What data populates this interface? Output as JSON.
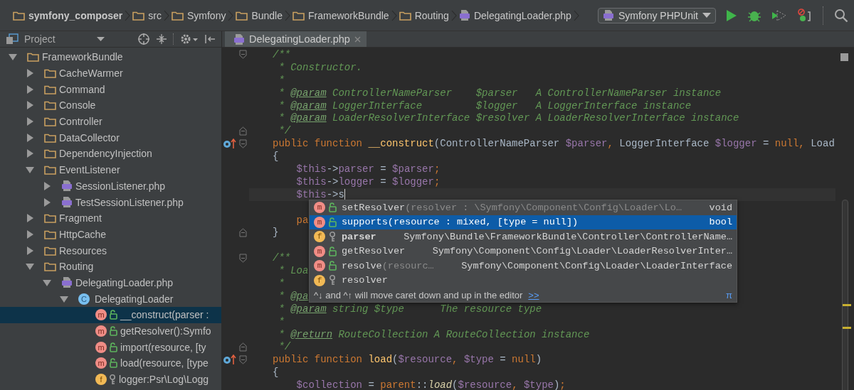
{
  "breadcrumbs": [
    {
      "label": "symfony_composer",
      "kind": "folder",
      "bold": true
    },
    {
      "label": "src",
      "kind": "folder",
      "bold": false
    },
    {
      "label": "Symfony",
      "kind": "folder",
      "bold": false
    },
    {
      "label": "Bundle",
      "kind": "folder",
      "bold": false
    },
    {
      "label": "FrameworkBundle",
      "kind": "folder",
      "bold": false
    },
    {
      "label": "Routing",
      "kind": "folder",
      "bold": false
    },
    {
      "label": "DelegatingLoader.php",
      "kind": "php",
      "bold": false
    }
  ],
  "run_config": {
    "label": "Symfony PHPUnit"
  },
  "project_panel": {
    "title": "Project",
    "tree": [
      {
        "label": "FrameworkBundle",
        "kind": "folder",
        "expanded": true,
        "selected": false,
        "children": [
          {
            "label": "CacheWarmer",
            "kind": "folder",
            "expanded": false,
            "selected": false
          },
          {
            "label": "Command",
            "kind": "folder",
            "expanded": false,
            "selected": false
          },
          {
            "label": "Console",
            "kind": "folder",
            "expanded": false,
            "selected": false
          },
          {
            "label": "Controller",
            "kind": "folder",
            "expanded": false,
            "selected": false
          },
          {
            "label": "DataCollector",
            "kind": "folder",
            "expanded": false,
            "selected": false
          },
          {
            "label": "DependencyInjection",
            "kind": "folder",
            "expanded": false,
            "selected": false
          },
          {
            "label": "EventListener",
            "kind": "folder",
            "expanded": true,
            "selected": false,
            "children": [
              {
                "label": "SessionListener.php",
                "kind": "php",
                "expanded": false,
                "selected": false
              },
              {
                "label": "TestSessionListener.php",
                "kind": "php",
                "expanded": false,
                "selected": false
              }
            ]
          },
          {
            "label": "Fragment",
            "kind": "folder",
            "expanded": false,
            "selected": false
          },
          {
            "label": "HttpCache",
            "kind": "folder",
            "expanded": false,
            "selected": false
          },
          {
            "label": "Resources",
            "kind": "folder",
            "expanded": false,
            "selected": false
          },
          {
            "label": "Routing",
            "kind": "folder",
            "expanded": true,
            "selected": false,
            "children": [
              {
                "label": "DelegatingLoader.php",
                "kind": "php",
                "expanded": true,
                "selected": false,
                "children": [
                  {
                    "label": "DelegatingLoader",
                    "kind": "class",
                    "badge": "C",
                    "expanded": true,
                    "selected": false,
                    "children": [
                      {
                        "label": "__construct(parser :",
                        "kind": "method",
                        "badge": "m",
                        "selected": true
                      },
                      {
                        "label": "getResolver():Symfo",
                        "kind": "method",
                        "badge": "m",
                        "selected": false
                      },
                      {
                        "label": "import(resource, [ty",
                        "kind": "method",
                        "badge": "m",
                        "selected": false
                      },
                      {
                        "label": "load(resource, [type",
                        "kind": "method",
                        "badge": "m",
                        "selected": false
                      },
                      {
                        "label": "logger:Psr\\Log\\Logg",
                        "kind": "field",
                        "badge": "f",
                        "selected": false
                      }
                    ]
                  }
                ]
              }
            ]
          }
        ]
      }
    ]
  },
  "editor": {
    "tabs": [
      {
        "label": "DelegatingLoader.php",
        "selected": true
      }
    ],
    "lines": [
      {
        "current": false,
        "fold_start": true,
        "fold_end": false,
        "overrides": false,
        "tokens": [
          {
            "kind": "comment",
            "text": "/**"
          }
        ]
      },
      {
        "current": false,
        "fold_start": false,
        "fold_end": false,
        "overrides": false,
        "tokens": [
          {
            "kind": "comment",
            "text": " * Constructor."
          }
        ]
      },
      {
        "current": false,
        "fold_start": false,
        "fold_end": false,
        "overrides": false,
        "tokens": [
          {
            "kind": "comment",
            "text": " *"
          }
        ]
      },
      {
        "current": false,
        "fold_start": false,
        "fold_end": false,
        "overrides": false,
        "tokens": [
          {
            "kind": "comment",
            "text": " * "
          },
          {
            "kind": "tag",
            "text": "@param"
          },
          {
            "kind": "comment",
            "text": " ControllerNameParser    $parser   A ControllerNameParser instance"
          }
        ]
      },
      {
        "current": false,
        "fold_start": false,
        "fold_end": false,
        "overrides": false,
        "tokens": [
          {
            "kind": "comment",
            "text": " * "
          },
          {
            "kind": "tag",
            "text": "@param"
          },
          {
            "kind": "comment",
            "text": " LoggerInterface         $logger   A LoggerInterface instance"
          }
        ]
      },
      {
        "current": false,
        "fold_start": false,
        "fold_end": false,
        "overrides": false,
        "tokens": [
          {
            "kind": "comment",
            "text": " * "
          },
          {
            "kind": "tag",
            "text": "@param"
          },
          {
            "kind": "comment",
            "text": " LoaderResolverInterface $resolver A LoaderResolverInterface instance"
          }
        ]
      },
      {
        "current": false,
        "fold_start": false,
        "fold_end": true,
        "overrides": false,
        "tokens": [
          {
            "kind": "comment",
            "text": " */"
          }
        ]
      },
      {
        "current": false,
        "fold_start": true,
        "fold_end": false,
        "overrides": true,
        "tokens": [
          {
            "kind": "keyword",
            "text": "public function "
          },
          {
            "kind": "function",
            "text": "__construct"
          },
          {
            "kind": "plain",
            "text": "(ControllerNameParser "
          },
          {
            "kind": "variable",
            "text": "$parser"
          },
          {
            "kind": "keyword",
            "text": ", "
          },
          {
            "kind": "plain",
            "text": "LoggerInterface "
          },
          {
            "kind": "variable",
            "text": "$logger"
          },
          {
            "kind": "plain",
            "text": " = "
          },
          {
            "kind": "keyword",
            "text": "null, "
          },
          {
            "kind": "plain",
            "text": "Load"
          }
        ]
      },
      {
        "current": false,
        "fold_start": false,
        "fold_end": false,
        "overrides": false,
        "tokens": [
          {
            "kind": "plain",
            "text": "{"
          }
        ]
      },
      {
        "current": false,
        "fold_start": false,
        "fold_end": false,
        "overrides": false,
        "tokens": [
          {
            "kind": "variable",
            "text": "    $this"
          },
          {
            "kind": "plain",
            "text": "->"
          },
          {
            "kind": "variable",
            "text": "parser"
          },
          {
            "kind": "plain",
            "text": " = "
          },
          {
            "kind": "variable",
            "text": "$parser"
          },
          {
            "kind": "keyword",
            "text": ";"
          }
        ]
      },
      {
        "current": false,
        "fold_start": false,
        "fold_end": false,
        "overrides": false,
        "tokens": [
          {
            "kind": "variable",
            "text": "    $this"
          },
          {
            "kind": "plain",
            "text": "->"
          },
          {
            "kind": "variable",
            "text": "logger"
          },
          {
            "kind": "plain",
            "text": " = "
          },
          {
            "kind": "variable",
            "text": "$logger"
          },
          {
            "kind": "keyword",
            "text": ";"
          }
        ]
      },
      {
        "current": true,
        "fold_start": false,
        "fold_end": false,
        "overrides": false,
        "tokens": [
          {
            "kind": "variable",
            "text": "    $this"
          },
          {
            "kind": "plain",
            "text": "->s"
          }
        ]
      },
      {
        "current": false,
        "fold_start": false,
        "fold_end": false,
        "overrides": false
      },
      {
        "current": false,
        "fold_start": false,
        "fold_end": false,
        "overrides": false,
        "tokens": [
          {
            "kind": "keyword",
            "text": "    pa"
          }
        ]
      },
      {
        "current": false,
        "fold_start": false,
        "fold_end": true,
        "overrides": false,
        "tokens": [
          {
            "kind": "plain",
            "text": "}"
          }
        ]
      },
      {
        "current": false,
        "fold_start": false,
        "fold_end": false,
        "overrides": false
      },
      {
        "current": false,
        "fold_start": true,
        "fold_end": false,
        "overrides": false,
        "tokens": [
          {
            "kind": "comment",
            "text": "/**"
          }
        ]
      },
      {
        "current": false,
        "fold_start": false,
        "fold_end": false,
        "overrides": false,
        "tokens": [
          {
            "kind": "comment",
            "text": " * Loa"
          }
        ]
      },
      {
        "current": false,
        "fold_start": false,
        "fold_end": false,
        "overrides": false,
        "tokens": [
          {
            "kind": "comment",
            "text": " *"
          }
        ]
      },
      {
        "current": false,
        "fold_start": false,
        "fold_end": false,
        "overrides": false,
        "tokens": [
          {
            "kind": "comment",
            "text": " * "
          },
          {
            "kind": "tag",
            "text": "@pa"
          }
        ]
      },
      {
        "current": false,
        "fold_start": false,
        "fold_end": false,
        "overrides": false,
        "tokens": [
          {
            "kind": "comment",
            "text": " * "
          },
          {
            "kind": "tag",
            "text": "@param"
          },
          {
            "kind": "comment",
            "text": " string $type      The resource type"
          }
        ]
      },
      {
        "current": false,
        "fold_start": false,
        "fold_end": false,
        "overrides": false,
        "tokens": [
          {
            "kind": "comment",
            "text": " *"
          }
        ]
      },
      {
        "current": false,
        "fold_start": false,
        "fold_end": false,
        "overrides": false,
        "tokens": [
          {
            "kind": "comment",
            "text": " * "
          },
          {
            "kind": "tag",
            "text": "@return"
          },
          {
            "kind": "comment",
            "text": " RouteCollection A RouteCollection instance"
          }
        ]
      },
      {
        "current": false,
        "fold_start": false,
        "fold_end": true,
        "overrides": false,
        "tokens": [
          {
            "kind": "comment",
            "text": " */"
          }
        ]
      },
      {
        "current": false,
        "fold_start": true,
        "fold_end": false,
        "overrides": true,
        "tokens": [
          {
            "kind": "keyword",
            "text": "public function "
          },
          {
            "kind": "function",
            "text": "load"
          },
          {
            "kind": "plain",
            "text": "("
          },
          {
            "kind": "variable",
            "text": "$resource"
          },
          {
            "kind": "keyword",
            "text": ", "
          },
          {
            "kind": "variable",
            "text": "$type"
          },
          {
            "kind": "plain",
            "text": " = "
          },
          {
            "kind": "keyword",
            "text": "null"
          },
          {
            "kind": "plain",
            "text": ")"
          }
        ]
      },
      {
        "current": false,
        "fold_start": false,
        "fold_end": false,
        "overrides": false,
        "tokens": [
          {
            "kind": "plain",
            "text": "{"
          }
        ]
      },
      {
        "current": false,
        "fold_start": false,
        "fold_end": false,
        "overrides": false,
        "tokens": [
          {
            "kind": "variable",
            "text": "    $collection"
          },
          {
            "kind": "plain",
            "text": " = "
          },
          {
            "kind": "keyword",
            "text": "parent"
          },
          {
            "kind": "plain",
            "text": "::"
          },
          {
            "kind": "call",
            "text": "load"
          },
          {
            "kind": "plain",
            "text": "("
          },
          {
            "kind": "variable",
            "text": "$resource"
          },
          {
            "kind": "keyword",
            "text": ", "
          },
          {
            "kind": "variable",
            "text": "$type"
          },
          {
            "kind": "plain",
            "text": ")"
          },
          {
            "kind": "keyword",
            "text": ";"
          }
        ]
      }
    ],
    "completion": {
      "items": [
        {
          "kind": "method",
          "badge": "m",
          "name": "setResolver",
          "params": "(resolver : \\Symfony\\Component\\Config\\Loader\\Lo…",
          "type": "void",
          "bold": false,
          "selected": false
        },
        {
          "kind": "method",
          "badge": "m",
          "name": "supports",
          "params": "(resource : mixed, [type = null])",
          "type": "bool",
          "bold": false,
          "selected": true
        },
        {
          "kind": "field",
          "badge": "f",
          "name": "parser",
          "type": "Symfony\\Bundle\\FrameworkBundle\\Controller\\ControllerName…",
          "bold": true,
          "selected": false
        },
        {
          "kind": "method",
          "badge": "m",
          "name": "getResolver",
          "type": "Symfony\\Component\\Config\\Loader\\LoaderResolverInter…",
          "bold": false,
          "selected": false
        },
        {
          "kind": "method",
          "badge": "m",
          "name": "resolve",
          "params": "(resourc…",
          "type": "Symfony\\Component\\Config\\Loader\\LoaderInterface",
          "bold": false,
          "selected": false
        },
        {
          "kind": "field",
          "badge": "f",
          "name": "resolver",
          "bold": false,
          "selected": false
        }
      ],
      "hint": "^↓ and ^↑ will move caret down and up in the editor",
      "hint_link": ">>",
      "hint_icon": "π"
    }
  }
}
